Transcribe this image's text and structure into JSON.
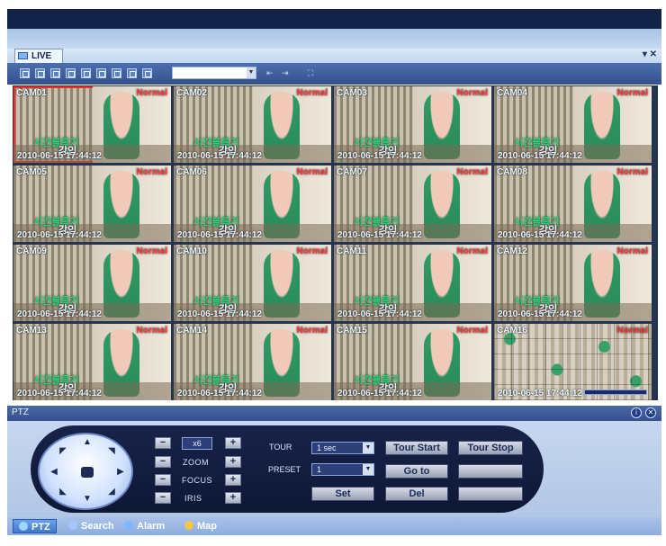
{
  "window": {
    "tab_label": "LIVE",
    "window_controls": "▾ ✕"
  },
  "toolbar": {
    "group_select_value": ""
  },
  "cameras": [
    {
      "label": "CAM01",
      "status": "Normal",
      "kor1": "시간블록기",
      "kor2": "강인",
      "stamp": "2010-06-15 17:44:12"
    },
    {
      "label": "CAM02",
      "status": "Normal",
      "kor1": "시간블록기",
      "kor2": "강인",
      "stamp": "2010-06-15 17:44:12"
    },
    {
      "label": "CAM03",
      "status": "Normal",
      "kor1": "시간블록기",
      "kor2": "강인",
      "stamp": "2010-06-15 17:44:12"
    },
    {
      "label": "CAM04",
      "status": "Normal",
      "kor1": "시간블록기",
      "kor2": "강인",
      "stamp": "2010-06-15 17:44:12"
    },
    {
      "label": "CAM05",
      "status": "Normal",
      "kor1": "시간블록기",
      "kor2": "강인",
      "stamp": "2010-06-15 17:44:12"
    },
    {
      "label": "CAM06",
      "status": "Normal",
      "kor1": "시간블록기",
      "kor2": "강인",
      "stamp": "2010-06-15 17:44:12"
    },
    {
      "label": "CAM07",
      "status": "Normal",
      "kor1": "시간블록기",
      "kor2": "강인",
      "stamp": "2010-06-15 17:44:12"
    },
    {
      "label": "CAM08",
      "status": "Normal",
      "kor1": "시간블록기",
      "kor2": "강인",
      "stamp": "2010-06-15 17:44:12"
    },
    {
      "label": "CAM09",
      "status": "Normal",
      "kor1": "시간블록기",
      "kor2": "강인",
      "stamp": "2010-06-15 17:44:12"
    },
    {
      "label": "CAM10",
      "status": "Normal",
      "kor1": "시간블록기",
      "kor2": "강인",
      "stamp": "2010-06-15 17:44:12"
    },
    {
      "label": "CAM11",
      "status": "Normal",
      "kor1": "시간블록기",
      "kor2": "강인",
      "stamp": "2010-06-15 17:44:12"
    },
    {
      "label": "CAM12",
      "status": "Normal",
      "kor1": "시간블록기",
      "kor2": "강인",
      "stamp": "2010-06-15 17:44:12"
    },
    {
      "label": "CAM13",
      "status": "Normal",
      "kor1": "시간블록기",
      "kor2": "강인",
      "stamp": "2010-06-15 17:44:12"
    },
    {
      "label": "CAM14",
      "status": "Normal",
      "kor1": "시간블록기",
      "kor2": "강인",
      "stamp": "2010-06-15 17:44:12"
    },
    {
      "label": "CAM15",
      "status": "Normal",
      "kor1": "시간블록기",
      "kor2": "강인",
      "stamp": "2010-06-15 17:44:12"
    },
    {
      "label": "CAM16",
      "status": "Normal",
      "kor1": "",
      "kor2": "",
      "stamp": "2010-06-15 17:44:12"
    }
  ],
  "ptz": {
    "title": "PTZ",
    "speed_value": "x6",
    "zoom_label": "ZOOM",
    "focus_label": "FOCUS",
    "iris_label": "IRIS",
    "tour_label": "TOUR",
    "preset_label": "PRESET",
    "tour_select_value": "1 sec",
    "preset_select_value": "1",
    "tour_start_label": "Tour Start",
    "tour_stop_label": "Tour Stop",
    "goto_label": "Go to",
    "set_label": "Set",
    "del_label": "Del",
    "blank_button_1": "",
    "blank_button_2": ""
  },
  "bottom_tabs": [
    {
      "label": "PTZ",
      "icon": "ptz-icon",
      "active": true
    },
    {
      "label": "Search",
      "icon": "search-icon",
      "active": false
    },
    {
      "label": "Alarm",
      "icon": "alarm-icon",
      "active": false
    },
    {
      "label": "Map",
      "icon": "map-icon",
      "active": false
    }
  ],
  "colors": {
    "accent": "#3f79cd",
    "status_red": "#ff3a3a",
    "panel_dark": "#0e1734"
  }
}
